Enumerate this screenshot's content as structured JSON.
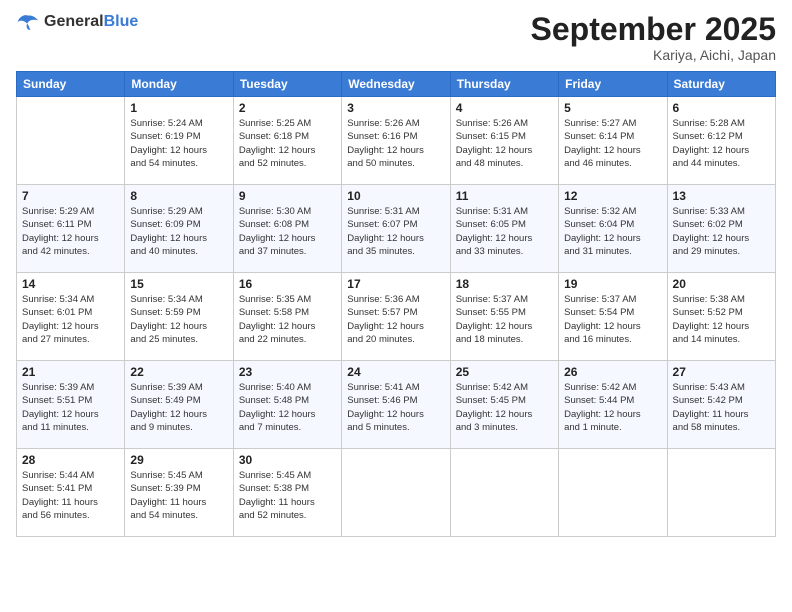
{
  "header": {
    "logo_general": "General",
    "logo_blue": "Blue",
    "month_title": "September 2025",
    "location": "Kariya, Aichi, Japan"
  },
  "days_of_week": [
    "Sunday",
    "Monday",
    "Tuesday",
    "Wednesday",
    "Thursday",
    "Friday",
    "Saturday"
  ],
  "weeks": [
    [
      {
        "day": "",
        "info": ""
      },
      {
        "day": "1",
        "info": "Sunrise: 5:24 AM\nSunset: 6:19 PM\nDaylight: 12 hours\nand 54 minutes."
      },
      {
        "day": "2",
        "info": "Sunrise: 5:25 AM\nSunset: 6:18 PM\nDaylight: 12 hours\nand 52 minutes."
      },
      {
        "day": "3",
        "info": "Sunrise: 5:26 AM\nSunset: 6:16 PM\nDaylight: 12 hours\nand 50 minutes."
      },
      {
        "day": "4",
        "info": "Sunrise: 5:26 AM\nSunset: 6:15 PM\nDaylight: 12 hours\nand 48 minutes."
      },
      {
        "day": "5",
        "info": "Sunrise: 5:27 AM\nSunset: 6:14 PM\nDaylight: 12 hours\nand 46 minutes."
      },
      {
        "day": "6",
        "info": "Sunrise: 5:28 AM\nSunset: 6:12 PM\nDaylight: 12 hours\nand 44 minutes."
      }
    ],
    [
      {
        "day": "7",
        "info": "Sunrise: 5:29 AM\nSunset: 6:11 PM\nDaylight: 12 hours\nand 42 minutes."
      },
      {
        "day": "8",
        "info": "Sunrise: 5:29 AM\nSunset: 6:09 PM\nDaylight: 12 hours\nand 40 minutes."
      },
      {
        "day": "9",
        "info": "Sunrise: 5:30 AM\nSunset: 6:08 PM\nDaylight: 12 hours\nand 37 minutes."
      },
      {
        "day": "10",
        "info": "Sunrise: 5:31 AM\nSunset: 6:07 PM\nDaylight: 12 hours\nand 35 minutes."
      },
      {
        "day": "11",
        "info": "Sunrise: 5:31 AM\nSunset: 6:05 PM\nDaylight: 12 hours\nand 33 minutes."
      },
      {
        "day": "12",
        "info": "Sunrise: 5:32 AM\nSunset: 6:04 PM\nDaylight: 12 hours\nand 31 minutes."
      },
      {
        "day": "13",
        "info": "Sunrise: 5:33 AM\nSunset: 6:02 PM\nDaylight: 12 hours\nand 29 minutes."
      }
    ],
    [
      {
        "day": "14",
        "info": "Sunrise: 5:34 AM\nSunset: 6:01 PM\nDaylight: 12 hours\nand 27 minutes."
      },
      {
        "day": "15",
        "info": "Sunrise: 5:34 AM\nSunset: 5:59 PM\nDaylight: 12 hours\nand 25 minutes."
      },
      {
        "day": "16",
        "info": "Sunrise: 5:35 AM\nSunset: 5:58 PM\nDaylight: 12 hours\nand 22 minutes."
      },
      {
        "day": "17",
        "info": "Sunrise: 5:36 AM\nSunset: 5:57 PM\nDaylight: 12 hours\nand 20 minutes."
      },
      {
        "day": "18",
        "info": "Sunrise: 5:37 AM\nSunset: 5:55 PM\nDaylight: 12 hours\nand 18 minutes."
      },
      {
        "day": "19",
        "info": "Sunrise: 5:37 AM\nSunset: 5:54 PM\nDaylight: 12 hours\nand 16 minutes."
      },
      {
        "day": "20",
        "info": "Sunrise: 5:38 AM\nSunset: 5:52 PM\nDaylight: 12 hours\nand 14 minutes."
      }
    ],
    [
      {
        "day": "21",
        "info": "Sunrise: 5:39 AM\nSunset: 5:51 PM\nDaylight: 12 hours\nand 11 minutes."
      },
      {
        "day": "22",
        "info": "Sunrise: 5:39 AM\nSunset: 5:49 PM\nDaylight: 12 hours\nand 9 minutes."
      },
      {
        "day": "23",
        "info": "Sunrise: 5:40 AM\nSunset: 5:48 PM\nDaylight: 12 hours\nand 7 minutes."
      },
      {
        "day": "24",
        "info": "Sunrise: 5:41 AM\nSunset: 5:46 PM\nDaylight: 12 hours\nand 5 minutes."
      },
      {
        "day": "25",
        "info": "Sunrise: 5:42 AM\nSunset: 5:45 PM\nDaylight: 12 hours\nand 3 minutes."
      },
      {
        "day": "26",
        "info": "Sunrise: 5:42 AM\nSunset: 5:44 PM\nDaylight: 12 hours\nand 1 minute."
      },
      {
        "day": "27",
        "info": "Sunrise: 5:43 AM\nSunset: 5:42 PM\nDaylight: 11 hours\nand 58 minutes."
      }
    ],
    [
      {
        "day": "28",
        "info": "Sunrise: 5:44 AM\nSunset: 5:41 PM\nDaylight: 11 hours\nand 56 minutes."
      },
      {
        "day": "29",
        "info": "Sunrise: 5:45 AM\nSunset: 5:39 PM\nDaylight: 11 hours\nand 54 minutes."
      },
      {
        "day": "30",
        "info": "Sunrise: 5:45 AM\nSunset: 5:38 PM\nDaylight: 11 hours\nand 52 minutes."
      },
      {
        "day": "",
        "info": ""
      },
      {
        "day": "",
        "info": ""
      },
      {
        "day": "",
        "info": ""
      },
      {
        "day": "",
        "info": ""
      }
    ]
  ]
}
